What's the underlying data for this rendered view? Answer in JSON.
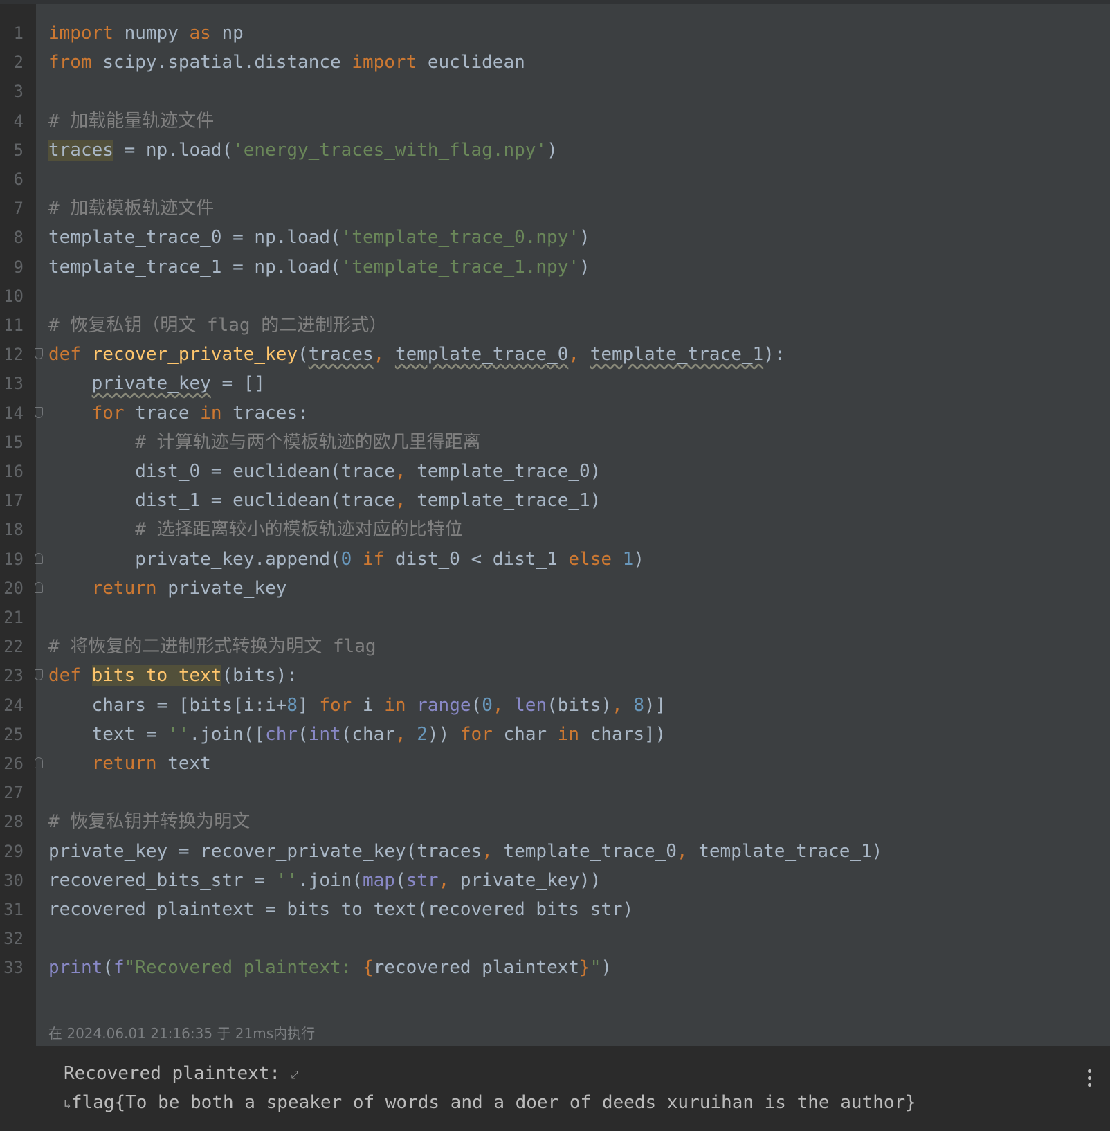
{
  "editor": {
    "lines": [
      "import numpy as np",
      "from scipy.spatial.distance import euclidean",
      "",
      "# 加载能量轨迹文件",
      "traces = np.load('energy_traces_with_flag.npy')",
      "",
      "# 加载模板轨迹文件",
      "template_trace_0 = np.load('template_trace_0.npy')",
      "template_trace_1 = np.load('template_trace_1.npy')",
      "",
      "# 恢复私钥（明文 flag 的二进制形式）",
      "def recover_private_key(traces, template_trace_0, template_trace_1):",
      "    private_key = []",
      "    for trace in traces:",
      "        # 计算轨迹与两个模板轨迹的欧几里得距离",
      "        dist_0 = euclidean(trace, template_trace_0)",
      "        dist_1 = euclidean(trace, template_trace_1)",
      "        # 选择距离较小的模板轨迹对应的比特位",
      "        private_key.append(0 if dist_0 < dist_1 else 1)",
      "    return private_key",
      "",
      "# 将恢复的二进制形式转换为明文 flag",
      "def bits_to_text(bits):",
      "    chars = [bits[i:i+8] for i in range(0, len(bits), 8)]",
      "    text = ''.join([chr(int(char, 2)) for char in chars])",
      "    return text",
      "",
      "# 恢复私钥并转换为明文",
      "private_key = recover_private_key(traces, template_trace_0, template_trace_1)",
      "recovered_bits_str = ''.join(map(str, private_key))",
      "recovered_plaintext = bits_to_text(recovered_bits_str)",
      "",
      "print(f\"Recovered plaintext: {recovered_plaintext}\")"
    ],
    "fold_markers": {
      "12": "open",
      "14": "open",
      "19": "close",
      "20": "close",
      "23": "open",
      "26": "close"
    }
  },
  "execution_info": "在 2024.06.01 21:16:35 于 21ms内执行",
  "output": {
    "lines": [
      "Recovered plaintext: ",
      "flag{To_be_both_a_speaker_of_words_and_a_doer_of_deeds_xuruihan_is_the_author}"
    ],
    "wrap_icons": [
      "⤦",
      "↳"
    ]
  },
  "colors": {
    "editor_bg": "#3c3f41",
    "gutter_bg": "#2b2b2b",
    "keyword": "#cc7832",
    "string": "#6a8759",
    "comment": "#808080",
    "number": "#6897bb",
    "function": "#ffc66d",
    "builtin": "#8888c6",
    "text": "#a9b7c6"
  },
  "icons": [
    "fold-open-icon",
    "fold-close-icon",
    "soft-wrap-icon",
    "more-options-icon"
  ]
}
